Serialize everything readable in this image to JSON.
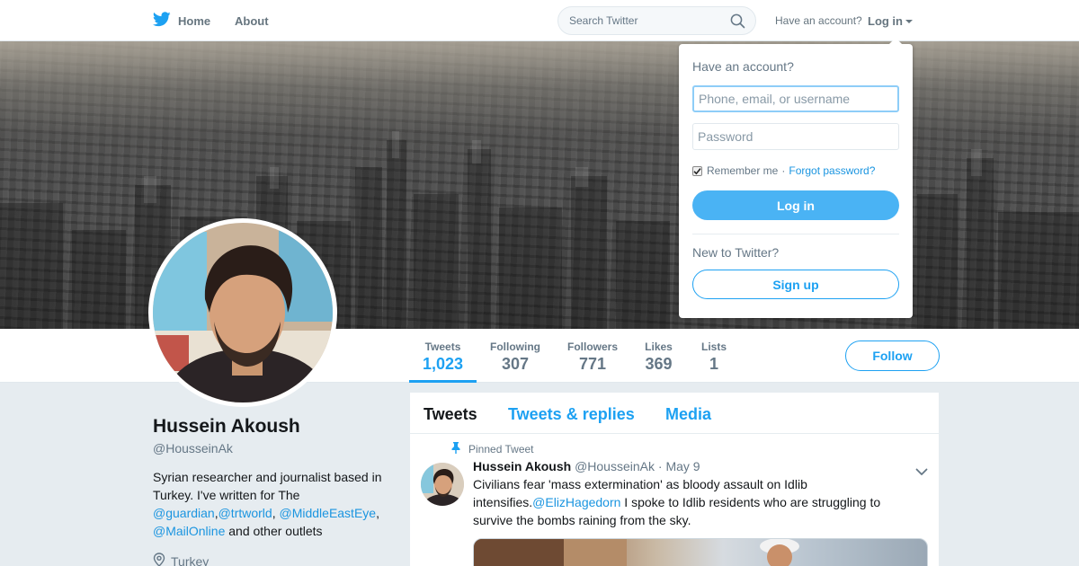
{
  "nav": {
    "home_label": "Home",
    "about_label": "About",
    "search_placeholder": "Search Twitter",
    "have_account": "Have an account?",
    "login_label": "Log in",
    "brand_color": "#1da1f2",
    "logo_icon": "twitter-bird-icon"
  },
  "profile": {
    "name": "Hussein Akoush",
    "handle": "@HousseinAk",
    "bio_parts": {
      "lead": "Syrian researcher and journalist based in Turkey. I've written for The ",
      "m1": "@guardian",
      "c1": ",",
      "m2": "@trtworld",
      "c2": ", ",
      "m3": "@MiddleEastEye",
      "c3": ", ",
      "m4": "@MailOnline",
      "tail": " and other outlets"
    },
    "location": "Turkey"
  },
  "stats": [
    {
      "label": "Tweets",
      "value": "1,023"
    },
    {
      "label": "Following",
      "value": "307"
    },
    {
      "label": "Followers",
      "value": "771"
    },
    {
      "label": "Likes",
      "value": "369"
    },
    {
      "label": "Lists",
      "value": "1"
    }
  ],
  "follow_label": "Follow",
  "timeline": {
    "tabs": [
      "Tweets",
      "Tweets & replies",
      "Media"
    ],
    "pinned_label": "Pinned Tweet",
    "tweet": {
      "author": "Hussein Akoush",
      "handle": "@HousseinAk",
      "sep": "·",
      "date": "May 9",
      "text_lead": "Civilians fear 'mass extermination' as bloody assault on Idlib intensifies.",
      "mention": "@ElizHagedorn",
      "text_tail": " I spoke to Idlib residents who are struggling to survive the bombs raining from the sky."
    }
  },
  "login_dropdown": {
    "title": "Have an account?",
    "username_placeholder": "Phone, email, or username",
    "password_placeholder": "Password",
    "remember_label": "Remember me",
    "separator": "·",
    "forgot_label": "Forgot password?",
    "login_button": "Log in",
    "new_label": "New to Twitter?",
    "signup_button": "Sign up"
  }
}
